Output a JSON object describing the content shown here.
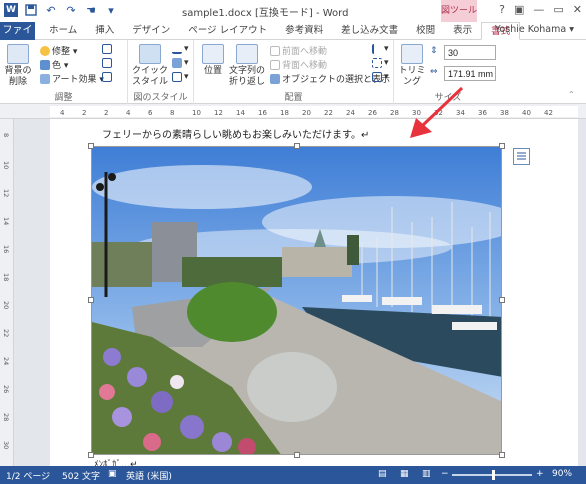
{
  "title_bar": {
    "doc_title": "sample1.docx [互換モード] - Word",
    "context_tools": "図ツール",
    "help": "?",
    "minimize": "—",
    "restore": "▭",
    "close": "✕"
  },
  "tabs": {
    "file": "ファイル",
    "items": [
      "ホーム",
      "挿入",
      "デザイン",
      "ページ レイアウト",
      "参考資料",
      "差し込み文書",
      "校閲",
      "表示",
      "書式"
    ],
    "active": "書式",
    "user": "Yoshie Kohama ▾"
  },
  "ribbon": {
    "adjust": {
      "remove_bg": "背景の削除",
      "corrections": "修整 ▾",
      "color": "色 ▾",
      "artistic": "アート効果 ▾",
      "label": "調整"
    },
    "styles": {
      "quick_styles": "クイック スタイル",
      "label": "図のスタイル"
    },
    "arrange": {
      "position": "位置",
      "wrap_text": "文字列の 折り返し",
      "bring_forward": "前面へ移動",
      "send_backward": "背面へ移動",
      "selection_pane": "オブジェクトの選択と表示",
      "label": "配置"
    },
    "size": {
      "crop": "トリミング",
      "height_value": "30",
      "width_value": "171.91 mm",
      "label": "サイズ"
    }
  },
  "ruler_numbers": [
    "4",
    "2",
    "2",
    "4",
    "6",
    "8",
    "10",
    "12",
    "14",
    "16",
    "18",
    "20",
    "22",
    "24",
    "26",
    "28",
    "30",
    "32",
    "34",
    "36",
    "38",
    "40",
    "42"
  ],
  "vruler_numbers": [
    "8",
    "10",
    "12",
    "14",
    "16",
    "18",
    "20",
    "22",
    "24",
    "26",
    "28",
    "30"
  ],
  "document": {
    "line1": "フェリーからの素晴らしい眺めもお楽しみいただけます。↵",
    "line2": "ﾒﾝﾎﾞｶﾞ…↵"
  },
  "status_bar": {
    "page": "1/2 ページ",
    "words": "502 文字",
    "language": "英語 (米国)",
    "zoom": "90%"
  },
  "colors": {
    "accent": "#2b579a",
    "context_tab": "#b0324e",
    "annotation_arrow": "#e8323c"
  }
}
